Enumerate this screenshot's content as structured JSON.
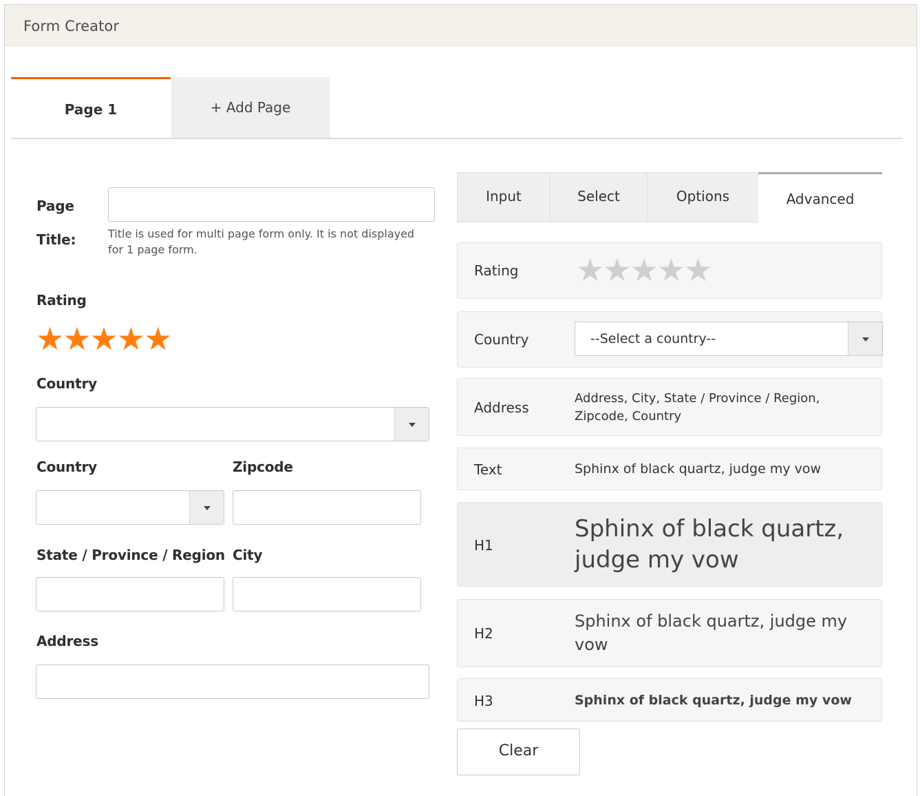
{
  "panel": {
    "title": "Form Creator"
  },
  "page_tabs": {
    "active": "Page 1",
    "add": "+ Add Page"
  },
  "form": {
    "page_title_label_1": "Page",
    "page_title_label_2": "Title:",
    "page_title_value": "",
    "page_title_hint": "Title is used for multi page form only. It is not displayed for 1 page form.",
    "rating_label": "Rating",
    "rating_value": 5,
    "rating_max": 5,
    "country_label": "Country",
    "country_value": "",
    "country2_label": "Country",
    "zipcode_label": "Zipcode",
    "state_label": "State / Province / Region",
    "city_label": "City",
    "address_label": "Address"
  },
  "tool_tabs": [
    "Input",
    "Select",
    "Options",
    "Advanced"
  ],
  "tool_fields": {
    "rating_label": "Rating",
    "country_label": "Country",
    "country_placeholder": "--Select a country--",
    "address_label": "Address",
    "address_value": "Address, City, State / Province / Region, Zipcode, Country",
    "text_label": "Text",
    "text_value": "Sphinx of black quartz, judge my vow",
    "h1_label": "H1",
    "h1_value": "Sphinx of black quartz, judge my vow",
    "h2_label": "H2",
    "h2_value": "Sphinx of black quartz, judge my vow",
    "h3_label": "H3",
    "h3_value": "Sphinx of black quartz, judge my vow"
  },
  "buttons": {
    "clear": "Clear"
  },
  "colors": {
    "accent": "#eb5e00",
    "star": "#ff7f0e",
    "star_empty": "#cfcfcf",
    "header_bg": "#f4f0ea"
  },
  "icons": {
    "star": "star-icon",
    "dropdown": "chevron-down-icon"
  }
}
